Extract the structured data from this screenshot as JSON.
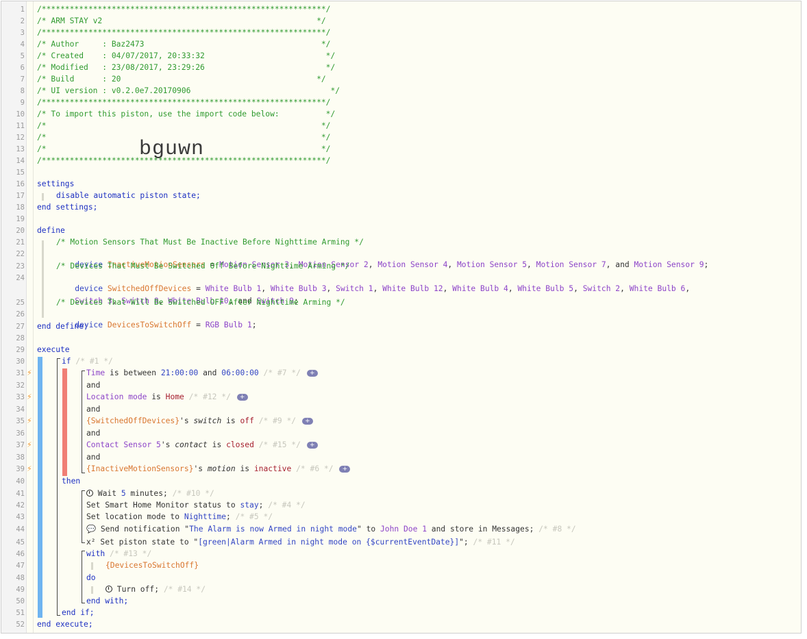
{
  "header": {
    "stars": "/*************************************************************/",
    "title_line": "/* ARM STAY v2                                              */",
    "author_line": "/* Author     : Baz2473                                      */",
    "created_line": "/* Created    : 04/07/2017, 20:33:32                          */",
    "modified_line": "/* Modified   : 23/08/2017, 23:29:26                          */",
    "build_line": "/* Build      : 20                                          */",
    "uiversion_line": "/* UI version : v0.2.0e7.20170906                              */",
    "import_line": "/* To import this piston, use the import code below:          */",
    "blank_line": "/*                                                           */",
    "import_code": "bguwn"
  },
  "settings": {
    "open": "settings",
    "body": "disable automatic piston state;",
    "close": "end settings;"
  },
  "define": {
    "open": "define",
    "c1": "/* Motion Sensors That Must Be Inactive Before Nighttime Arming */",
    "c2": "/* Devices That Must Be Switched Off Before Nighttime Arming */",
    "c3": "/* Devices That Will Be Switched OFF After Nighttime Arming */",
    "device_kw": "device",
    "var1": "InactiveMotionSensors",
    "var2": "SwitchedOffDevices",
    "var3": "DevicesToSwitchOff",
    "eq": " = ",
    "list1": [
      "Motion Sensor 3",
      "Motion Sensor 2",
      "Motion Sensor 4",
      "Motion Sensor 5",
      "Motion Sensor 7",
      "Motion Sensor 9"
    ],
    "list2a": [
      "White Bulb 1",
      "White Bulb 3",
      "Switch 1",
      "White Bulb 12",
      "White Bulb 4",
      "White Bulb 5",
      "Switch 2",
      "White Bulb 6"
    ],
    "list2b": [
      "Switch 3",
      "Switch 8",
      "White Bulb 10",
      "Switch 9"
    ],
    "list3": "RGB Bulb 1",
    "close": "end define;"
  },
  "execute": {
    "open": "execute",
    "if": "if",
    "if_c": "/* #1 */",
    "cond1": {
      "a": "Time",
      "b": " is between ",
      "c": "21:00:00",
      "d": " and ",
      "e": "06:00:00",
      "f": "/* #7 */"
    },
    "and": "and",
    "cond2": {
      "a": "Location mode",
      "b": " is ",
      "c": "Home",
      "f": "/* #12 */"
    },
    "cond3": {
      "a": "{SwitchedOffDevices}",
      "b": "'s ",
      "c": "switch",
      "d": " is ",
      "e": "off",
      "f": "/* #9 */"
    },
    "cond4": {
      "a": "Contact Sensor 5",
      "b": "'s ",
      "c": "contact",
      "d": " is ",
      "e": "closed",
      "f": "/* #15 */"
    },
    "cond5": {
      "a": "{InactiveMotionSensors}",
      "b": "'s ",
      "c": "motion",
      "d": " is ",
      "e": "inactive",
      "f": "/* #6 */"
    },
    "then": "then",
    "a1": {
      "a": " Wait ",
      "b": "5",
      "c": " minutes; ",
      "f": "/* #10 */"
    },
    "a2": {
      "a": "Set Smart Home Monitor status to ",
      "b": "stay",
      "c": "; ",
      "f": "/* #4 */"
    },
    "a3": {
      "a": "Set location mode to ",
      "b": "Nighttime",
      "c": "; ",
      "f": "/* #5 */"
    },
    "a4": {
      "ico": "💬",
      "a": " Send notification \"",
      "b": "The Alarm is now Armed in night mode",
      "c": "\" to ",
      "d": "John Doe 1",
      "e": " and store in Messages; ",
      "f": "/* #8 */"
    },
    "a5": {
      "ico": "x²",
      "a": " Set piston state to \"",
      "b": "[green|Alarm Armed in night mode on {$currentEventDate}]",
      "c": "\"; ",
      "f": "/* #11 */"
    },
    "with": "with",
    "with_c": "/* #13 */",
    "with_dev": "{DevicesToSwitchOff}",
    "do": "do",
    "turnoff": " Turn off; ",
    "turnoff_c": "/* #14 */",
    "end_with": "end with;",
    "end_if": "end if;",
    "close": "end execute;"
  },
  "plus": "+",
  "bolt_icon": "⚡"
}
